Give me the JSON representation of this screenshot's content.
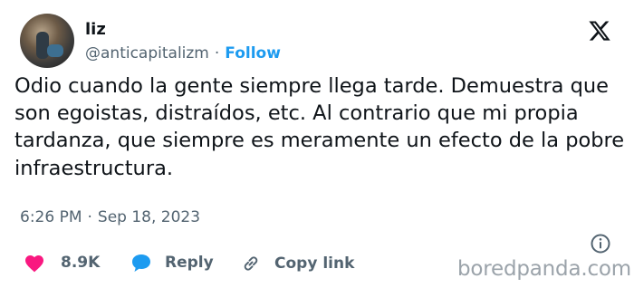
{
  "author": {
    "name": "liz",
    "handle": "@anticapitalizm",
    "separator": "·",
    "follow_label": "Follow"
  },
  "tweet": {
    "text": "Odio cuando la gente siempre llega tarde. Demuestra que son egoistas, distraídos, etc. Al contrario que mi propia tardanza, que siempre es meramente un efecto de la pobre infraestructura.",
    "time": "6:26 PM",
    "separator": "·",
    "date": "Sep 18, 2023"
  },
  "actions": {
    "likes": "8.9K",
    "reply_label": "Reply",
    "copy_label": "Copy link"
  },
  "watermark": "boredpanda.com",
  "colors": {
    "accent": "#1d9bf0",
    "like": "#f91880",
    "text": "#0f1419",
    "muted": "#536471"
  },
  "icons": [
    "x-logo-icon",
    "info-icon",
    "heart-icon",
    "reply-bubble-icon",
    "link-icon"
  ]
}
